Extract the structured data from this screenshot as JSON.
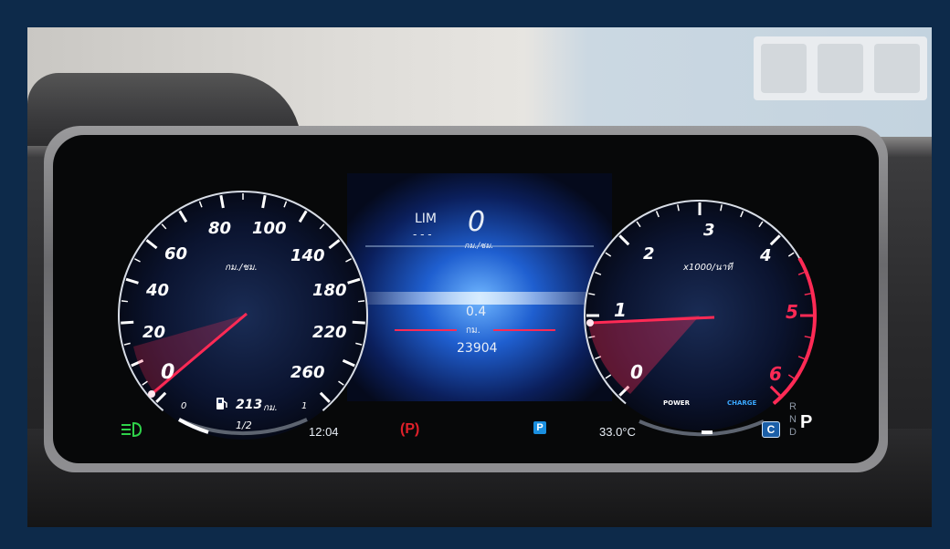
{
  "speedometer": {
    "ticks": [
      "0",
      "20",
      "40",
      "60",
      "80",
      "100",
      "140",
      "180",
      "220",
      "260"
    ],
    "unit": "กม./ชม.",
    "needle_value_kmh": 0
  },
  "fuel": {
    "empty_label": "0",
    "half_label": "1/2",
    "full_label": "1",
    "range_value": "213",
    "range_unit": "กม.",
    "level_fraction": 0.25
  },
  "center": {
    "limiter_label": "LIM",
    "limiter_value": "- - -",
    "speed_value": "0",
    "speed_unit": "กม./ชม.",
    "trip_value": "0.4",
    "trip_unit": "กม.",
    "odometer": "23904"
  },
  "tachometer": {
    "ticks": [
      "0",
      "1",
      "2",
      "3",
      "4",
      "5",
      "6"
    ],
    "unit": "x1000/นาที",
    "needle_value_rpm_x1000": 1,
    "power_label": "POWER",
    "charge_label": "CHARGE"
  },
  "status_bar": {
    "clock": "12:04",
    "parking_brake_symbol": "(P)",
    "parking_symbol": "P",
    "outside_temp": "33.0°C",
    "drive_mode": "C"
  },
  "gear_selector": {
    "options": [
      "R",
      "N",
      "D"
    ],
    "current": "P"
  },
  "colors": {
    "accent_red": "#ff2a55",
    "headlight_green": "#2fd24a",
    "parking_blue": "#1a8fe0",
    "brake_red": "#e0202a",
    "charge_blue": "#3aa8ff"
  }
}
